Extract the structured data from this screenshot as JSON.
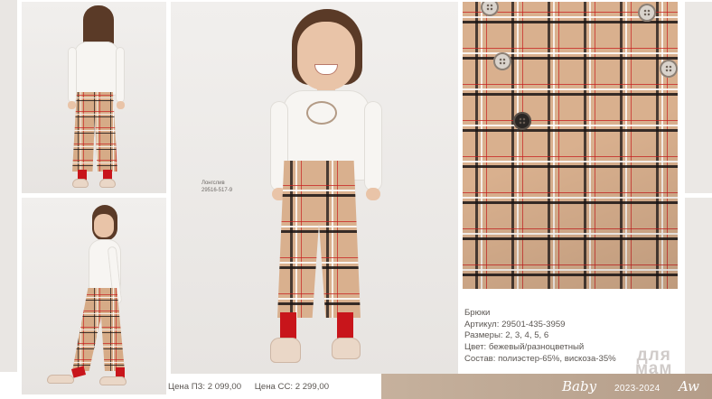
{
  "photos": {
    "main_caption": {
      "line1": "Лонгслив",
      "line2": "29516-517-9"
    }
  },
  "product": {
    "name": "Брюки",
    "article": "Артикул: 29501-435-3959",
    "sizes": "Размеры: 2, 3, 4, 5, 6",
    "color": "Цвет: бежевый/разноцветный",
    "composition": "Состав: полиэстер-65%, вискоза-35%"
  },
  "prices": {
    "price_pz": "Цена ПЗ: 2 099,00",
    "price_ss": "Цена СС: 2 299,00"
  },
  "footer": {
    "brand": "Baby",
    "season": "2023-2024",
    "collection": "Aw"
  },
  "watermark": {
    "line1": "для",
    "line2": "мам"
  },
  "colors": {
    "plaid_beige": "#d9b08e",
    "sock_red": "#c8151b",
    "footer_band": "#c6b19d",
    "text_gray": "#5b5652"
  }
}
